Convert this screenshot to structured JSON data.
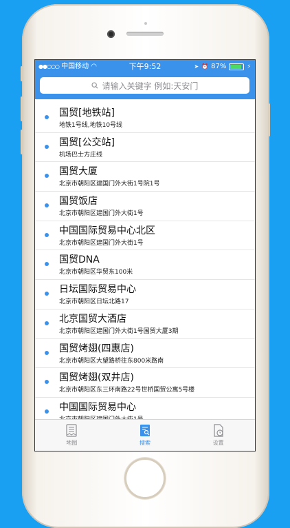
{
  "status_bar": {
    "carrier": "中国移动",
    "time": "下午9:52",
    "battery": "87%"
  },
  "search": {
    "placeholder": "请输入关键字 例如:天安门"
  },
  "results": [
    {
      "title": "国贸[地铁站]",
      "subtitle": "地铁1号线,地铁10号线"
    },
    {
      "title": "国贸[公交站]",
      "subtitle": "机场巴士方庄线"
    },
    {
      "title": "国贸大厦",
      "subtitle": "北京市朝阳区建国门外大街1号院1号"
    },
    {
      "title": "国贸饭店",
      "subtitle": "北京市朝阳区建国门外大街1号"
    },
    {
      "title": "中国国际贸易中心北区",
      "subtitle": "北京市朝阳区建国门外大街1号"
    },
    {
      "title": "国贸DNA",
      "subtitle": "北京市朝阳区华贸东100米"
    },
    {
      "title": "日坛国际贸易中心",
      "subtitle": "北京市朝阳区日坛北路17"
    },
    {
      "title": "北京国贸大酒店",
      "subtitle": "北京市朝阳区建国门外大街1号国贸大厦3期"
    },
    {
      "title": "国贸烤翅(四惠店)",
      "subtitle": "北京市朝阳区大望路桥往东800米路南"
    },
    {
      "title": "国贸烤翅(双井店)",
      "subtitle": "北京市朝阳区东三环南路22号世桥国贸公寓5号楼"
    },
    {
      "title": "中国国际贸易中心",
      "subtitle": "北京市朝阳区建国门外大街1号"
    }
  ],
  "tabs": [
    {
      "label": "地图",
      "icon": "map-document-icon",
      "active": false
    },
    {
      "label": "搜索",
      "icon": "search-document-icon",
      "active": true
    },
    {
      "label": "设置",
      "icon": "settings-clock-icon",
      "active": false
    }
  ],
  "colors": {
    "accent": "#3b92ea",
    "background": "#1aa0f3"
  }
}
